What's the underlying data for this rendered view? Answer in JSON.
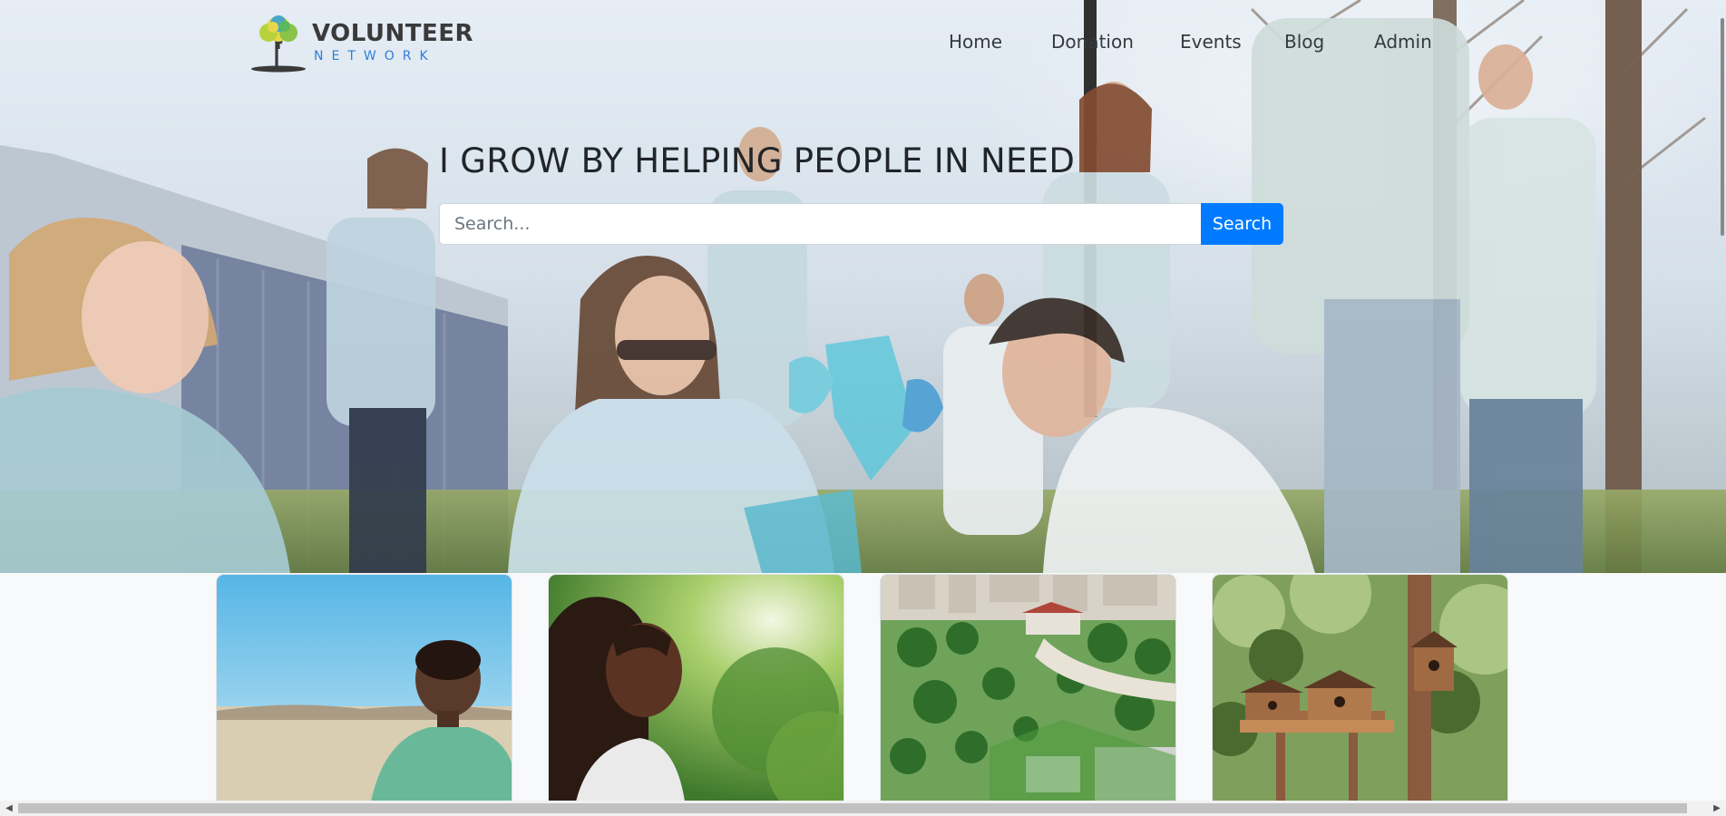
{
  "brand": {
    "name_line1": "VOLUNTEER",
    "name_line2": "NETWORK",
    "icon": "tree-logo-icon",
    "colors": {
      "primary_text": "#3a3a3a",
      "accent": "#2a7fd8",
      "tree_green": "#8bc34a",
      "tree_yellow": "#e6d84a"
    }
  },
  "nav": {
    "items": [
      {
        "label": "Home"
      },
      {
        "label": "Donation"
      },
      {
        "label": "Events"
      },
      {
        "label": "Blog"
      },
      {
        "label": "Admin"
      }
    ]
  },
  "hero": {
    "headline": "I GROW BY HELPING PEOPLE IN NEED",
    "background": "photo-volunteers-cleanup"
  },
  "search": {
    "placeholder": "Search...",
    "value": "",
    "button_label": "Search",
    "button_color": "#007bff"
  },
  "cards": [
    {
      "image": "photo-child-green-shirt"
    },
    {
      "image": "photo-girl-smiling-park"
    },
    {
      "image": "photo-city-park-aerial"
    },
    {
      "image": "photo-birdhouses-trees"
    }
  ],
  "scrollbar": {
    "left_arrow": "◀",
    "right_arrow": "▶"
  }
}
